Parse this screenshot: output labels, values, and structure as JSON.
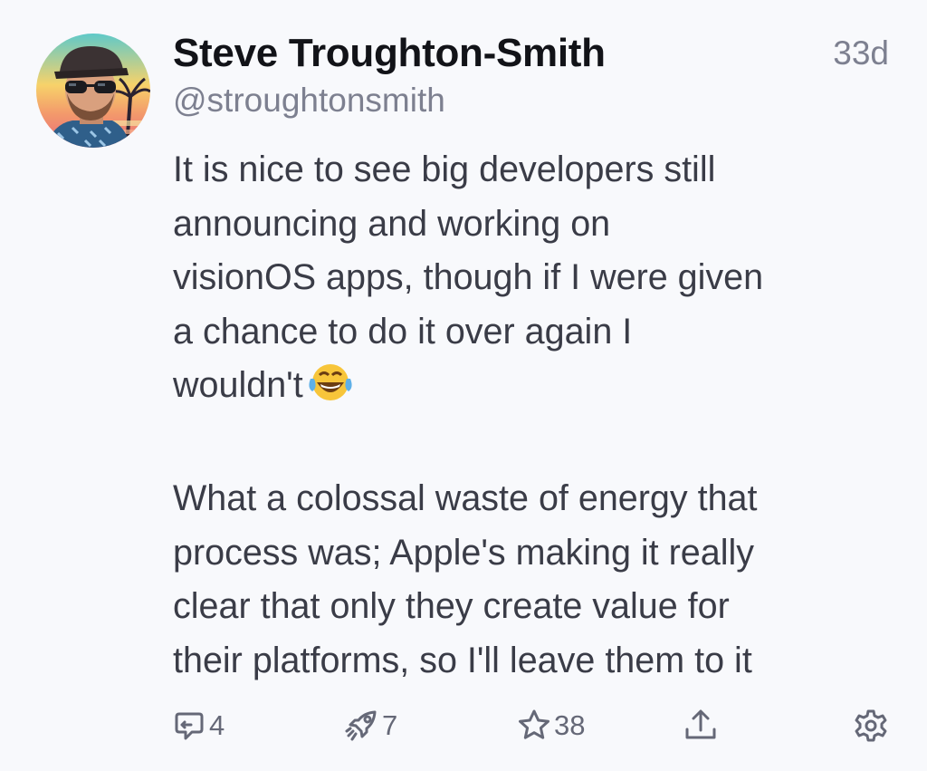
{
  "post": {
    "author": {
      "display_name": "Steve Troughton-Smith",
      "handle": "@stroughtonsmith",
      "avatar_icon": "user-avatar-photo"
    },
    "timestamp": "33d",
    "content": {
      "paragraph_1": "It is nice to see big developers still\nannouncing and working on\nvisionOS apps, though if I were given\na chance to do it over again I\nwouldn't",
      "paragraph_1_emoji": "😂",
      "paragraph_2": "What a colossal waste of energy that\nprocess was; Apple's making it really\nclear that only they create value for\ntheir platforms, so I'll leave them to it"
    },
    "actions": {
      "reply": {
        "icon": "reply-icon",
        "count": "4"
      },
      "boost": {
        "icon": "boost-icon",
        "count": "7"
      },
      "favourite": {
        "icon": "star-icon",
        "count": "38"
      },
      "share": {
        "icon": "share-icon"
      },
      "more": {
        "icon": "gear-icon"
      }
    }
  },
  "colors": {
    "background": "#f8f9fc",
    "name": "#121318",
    "secondary_text": "#7d8090",
    "body_text": "#3a3c47",
    "action_icons": "#656877"
  }
}
